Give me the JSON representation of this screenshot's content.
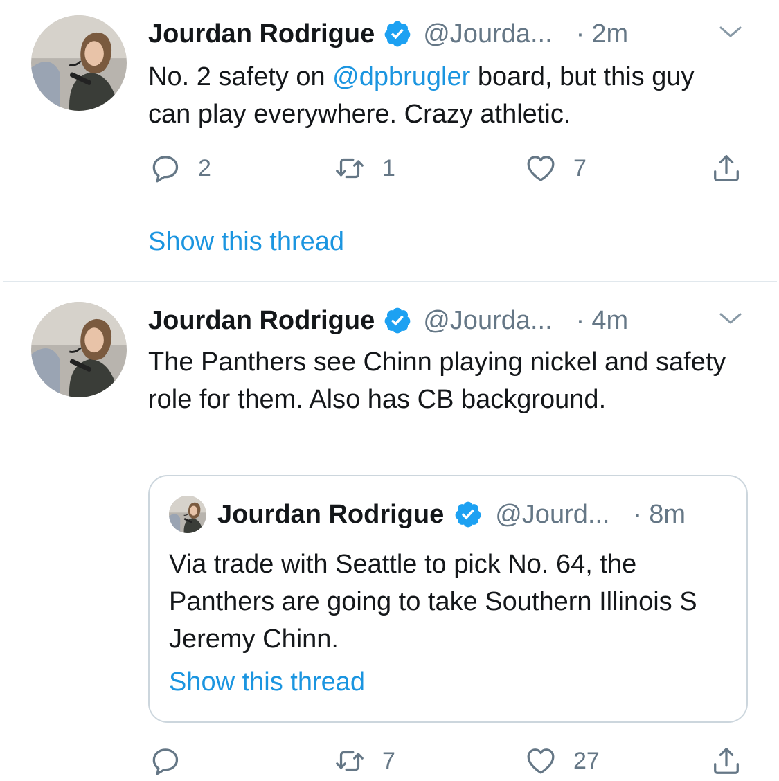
{
  "colors": {
    "accent": "#1b95e0",
    "verified": "#1da1f2",
    "secondary": "#657786",
    "text": "#14171a",
    "divider": "#e1e8ed"
  },
  "tweets": [
    {
      "name": "Jourdan Rodrigue",
      "handle": "@Jourda...",
      "dot": "·",
      "time": "2m",
      "text_before": "No. 2 safety on ",
      "mention": "@dpbrugler",
      "text_after": " board, but this guy can play everywhere. Crazy athletic.",
      "replies": "2",
      "retweets": "1",
      "likes": "7",
      "show_thread": "Show this thread",
      "icons": [
        "verified-icon",
        "chevron-down-icon",
        "reply-icon",
        "retweet-icon",
        "like-icon",
        "share-icon"
      ]
    },
    {
      "name": "Jourdan Rodrigue",
      "handle": "@Jourda...",
      "dot": "·",
      "time": "4m",
      "text": "The Panthers see Chinn playing nickel and safety role for them. Also has CB background.",
      "quote": {
        "name": "Jourdan Rodrigue",
        "handle": "@Jourd...",
        "dot": "·",
        "time": "8m",
        "text": "Via trade with Seattle to pick No. 64, the Panthers are going to take Southern Illinois S Jeremy Chinn.",
        "show_thread": "Show this thread"
      },
      "replies": "",
      "retweets": "7",
      "likes": "27"
    }
  ]
}
